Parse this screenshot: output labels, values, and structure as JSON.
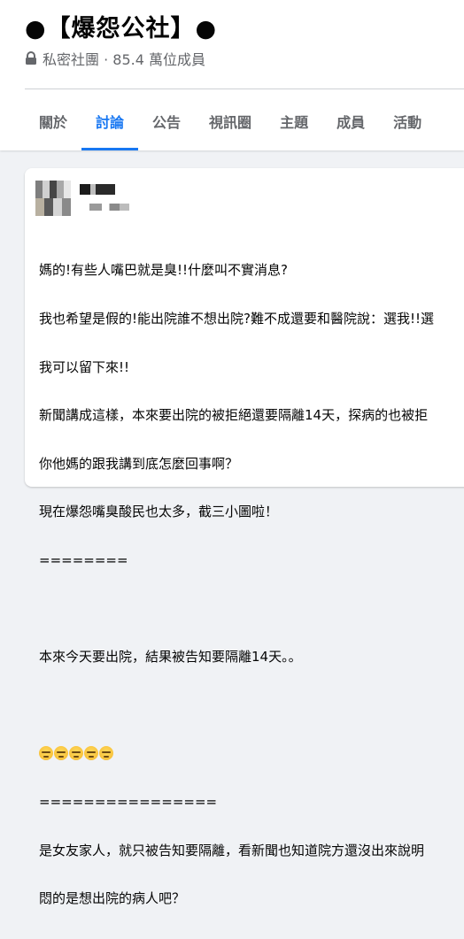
{
  "group": {
    "title": "●【爆怨公社】●",
    "meta": "私密社團 · 85.4 萬位成員"
  },
  "tabs": [
    {
      "label": "關於"
    },
    {
      "label": "討論",
      "active": true
    },
    {
      "label": "公告"
    },
    {
      "label": "視訊圈"
    },
    {
      "label": "主題"
    },
    {
      "label": "成員"
    },
    {
      "label": "活動"
    }
  ],
  "post": {
    "lines": [
      "媽的!有些人嘴巴就是臭!!什麼叫不實消息?",
      "我也希望是假的!能出院誰不想出院?難不成還要和醫院說：選我!!選",
      "我可以留下來!!",
      "新聞講成這樣，本來要出院的被拒絕還要隔離14天，探病的也被拒",
      "你他媽的跟我講到底怎麼回事啊？",
      "現在爆怨嘴臭酸民也太多，截三小圖啦！",
      "========",
      "",
      "本來今天要出院，結果被告知要隔離14天。。",
      "",
      "",
      "================",
      "是女友家人，就只被告知要隔離，看新聞也知道院方還沒出來說明",
      "悶的是想出院的病人吧？"
    ],
    "emoji_count": 5,
    "emoji_icon": "unamused-face-icon"
  },
  "colors": {
    "accent": "#1877f2",
    "muted": "#65676b",
    "background": "#f0f2f5"
  }
}
